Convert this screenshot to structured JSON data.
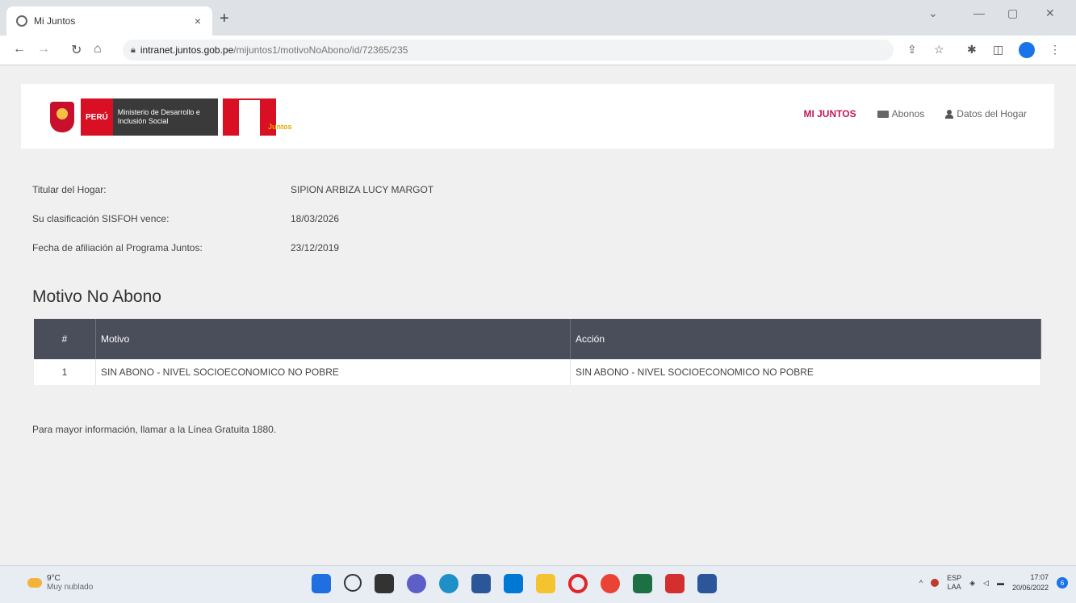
{
  "browser": {
    "tab_title": "Mi Juntos",
    "tab_close": "×",
    "new_tab": "+",
    "url_domain": "intranet.juntos.gob.pe",
    "url_path": "/mijuntos1/motivoNoAbono/id/72365/235",
    "window_controls": [
      "⌄",
      "—",
      "▢",
      "✕"
    ]
  },
  "header": {
    "peru_label": "PERÚ",
    "ministry_label": "Ministerio de Desarrollo e Inclusión Social",
    "program_tag": "Juntos",
    "nav": [
      {
        "label": "MI JUNTOS",
        "icon": "none",
        "active": true
      },
      {
        "label": "Abonos",
        "icon": "money-icon",
        "active": false
      },
      {
        "label": "Datos del Hogar",
        "icon": "user-icon",
        "active": false
      }
    ]
  },
  "info": {
    "titular_label": "Titular del Hogar:",
    "titular_value": "SIPION ARBIZA LUCY MARGOT",
    "sisfoh_label": "Su clasificación SISFOH vence:",
    "sisfoh_value": "18/03/2026",
    "afiliacion_label": "Fecha de afiliación al Programa Juntos:",
    "afiliacion_value": "23/12/2019"
  },
  "section_title": "Motivo No Abono",
  "table": {
    "headers": [
      "#",
      "Motivo",
      "Acción"
    ],
    "rows": [
      [
        "1",
        "SIN ABONO - NIVEL SOCIOECONOMICO NO POBRE",
        "SIN ABONO - NIVEL SOCIOECONOMICO NO POBRE"
      ]
    ]
  },
  "footnote": "Para mayor información, llamar a la Línea Gratuita 1880.",
  "taskbar": {
    "weather_temp": "9°C",
    "weather_desc": "Muy nublado",
    "lang_top": "ESP",
    "lang_bottom": "LAA",
    "time": "17:07",
    "date": "20/06/2022",
    "notif_count": "6"
  },
  "colors": {
    "accent": "#c2185b",
    "table_header": "#4a4d5a",
    "peru_red": "#d91023"
  }
}
